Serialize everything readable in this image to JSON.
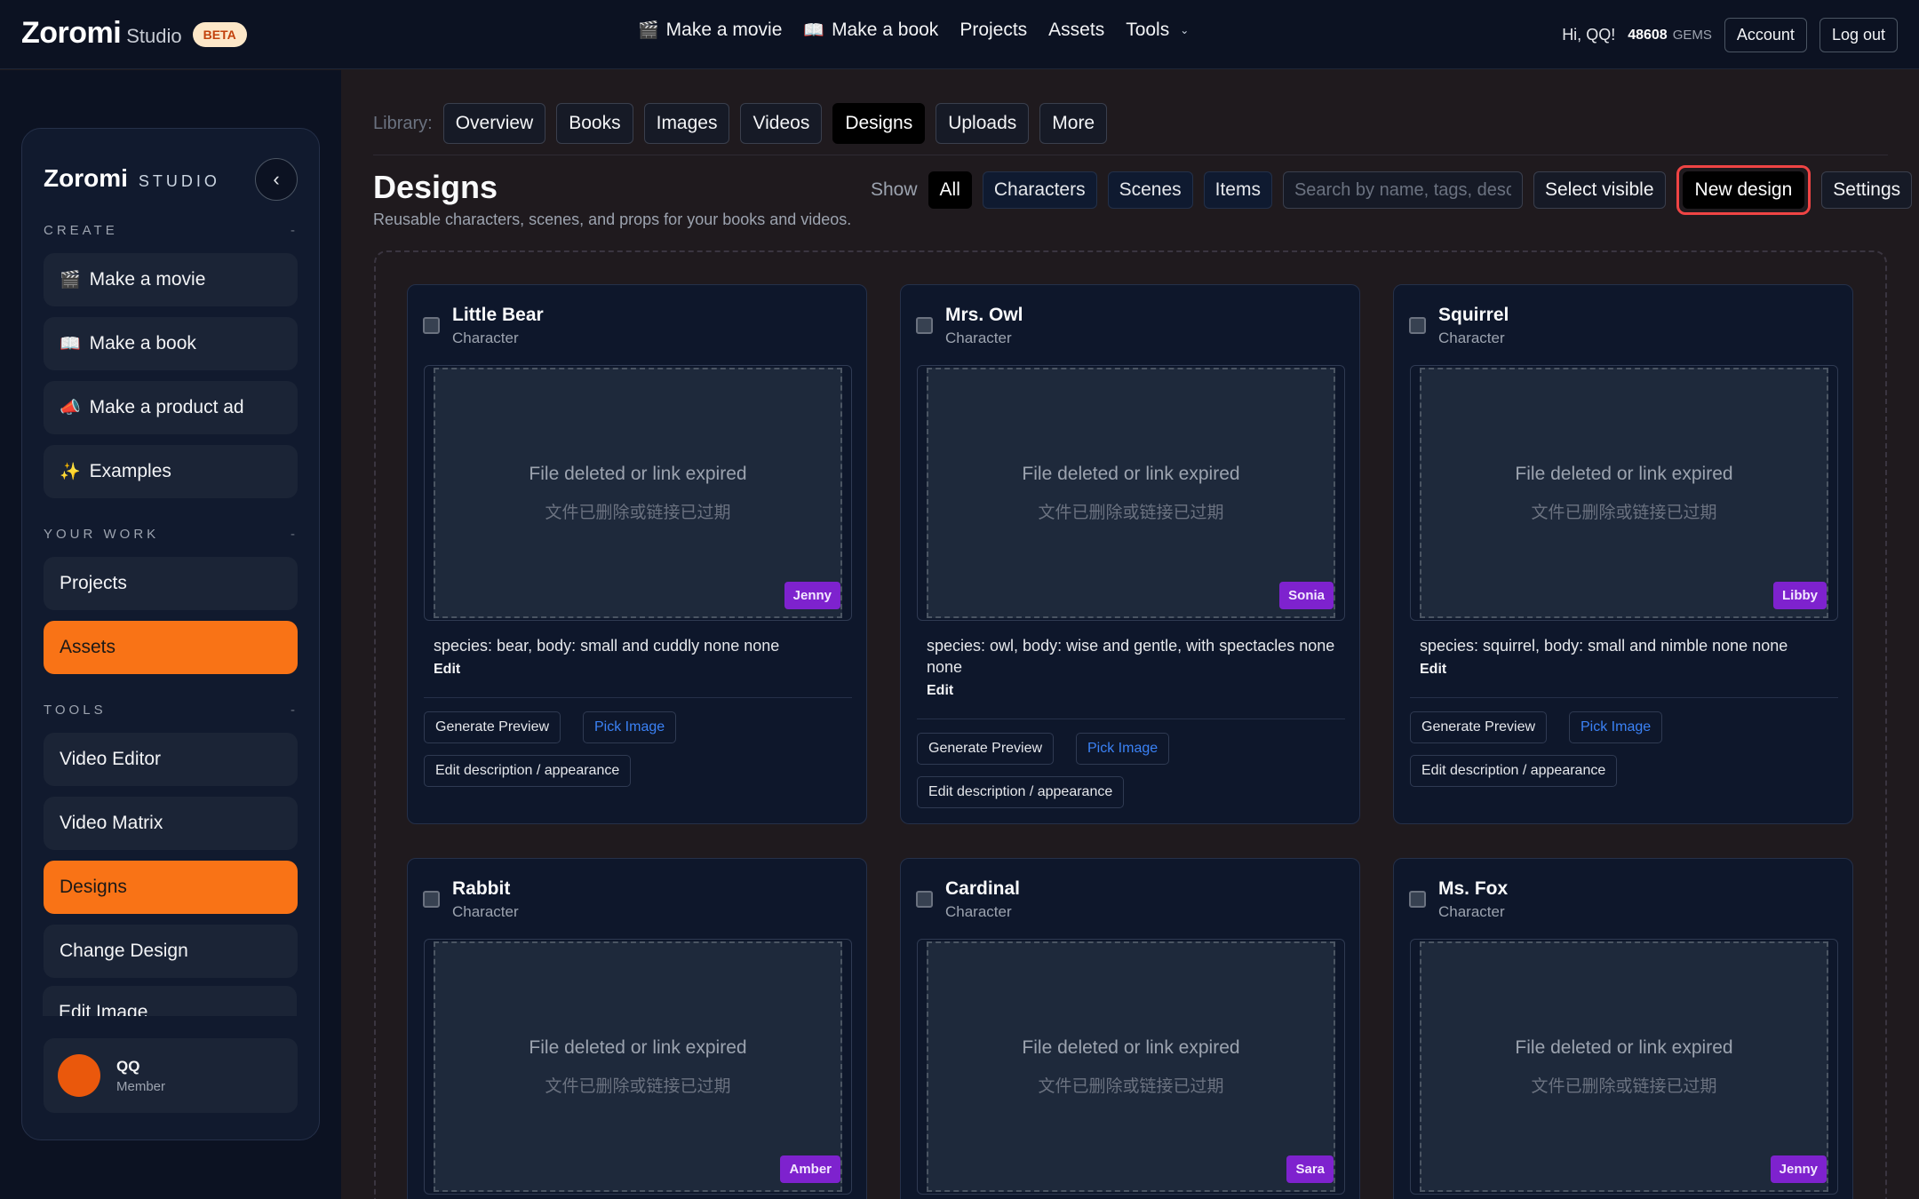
{
  "topbar": {
    "brand": "Zoromi",
    "brand_sub": "Studio",
    "beta": "BETA",
    "nav": [
      {
        "icon": "clapper-icon",
        "glyph": "🎬",
        "label": "Make a movie"
      },
      {
        "icon": "book-icon",
        "glyph": "📖",
        "label": "Make a book"
      },
      {
        "label": "Projects"
      },
      {
        "label": "Assets"
      },
      {
        "label": "Tools"
      }
    ],
    "greeting": "Hi, QQ!",
    "gems_value": "48608",
    "gems_unit": "GEMS",
    "account": "Account",
    "logout": "Log out"
  },
  "sidebar": {
    "brand": "Zoromi",
    "brand_sub": "STUDIO",
    "collapse_glyph": "‹",
    "sections": [
      {
        "label": "CREATE",
        "dash": "-"
      },
      {
        "label": "YOUR WORK",
        "dash": "-"
      },
      {
        "label": "TOOLS",
        "dash": "-"
      }
    ],
    "create": [
      {
        "glyph": "🎬",
        "label": "Make a movie"
      },
      {
        "glyph": "📖",
        "label": "Make a book"
      },
      {
        "glyph": "📣",
        "label": "Make a product ad"
      },
      {
        "glyph": "✨",
        "label": "Examples"
      }
    ],
    "work": [
      {
        "label": "Projects"
      },
      {
        "label": "Assets"
      }
    ],
    "tools": [
      {
        "label": "Video Editor"
      },
      {
        "label": "Video Matrix"
      },
      {
        "label": "Designs"
      },
      {
        "label": "Change Design"
      },
      {
        "label": "Edit Image"
      }
    ],
    "user": {
      "name": "QQ",
      "role": "Member"
    }
  },
  "library": {
    "label": "Library:",
    "tabs": [
      "Overview",
      "Books",
      "Images",
      "Videos",
      "Designs",
      "Uploads",
      "More"
    ],
    "active_tab": "Designs"
  },
  "page": {
    "title": "Designs",
    "subtitle": "Reusable characters, scenes, and props for your books and videos."
  },
  "filters": {
    "show_label": "Show",
    "chips": [
      "All",
      "Characters",
      "Scenes",
      "Items"
    ],
    "active_chip": "All",
    "search_placeholder": "Search by name, tags, description",
    "select_visible": "Select visible",
    "new_design": "New design",
    "settings": "Settings"
  },
  "preview_text": {
    "line1": "File deleted or link expired",
    "line2": "文件已删除或链接已过期"
  },
  "actions": {
    "generate": "Generate Preview",
    "pick": "Pick Image",
    "edit_desc": "Edit description / appearance",
    "edit": "Edit"
  },
  "designs": [
    {
      "name": "Little Bear",
      "type": "Character",
      "badge": "Jenny",
      "desc": "species: bear, body: small and cuddly none none"
    },
    {
      "name": "Mrs. Owl",
      "type": "Character",
      "badge": "Sonia",
      "desc": "species: owl, body: wise and gentle, with spectacles none none"
    },
    {
      "name": "Squirrel",
      "type": "Character",
      "badge": "Libby",
      "desc": "species: squirrel, body: small and nimble none none"
    },
    {
      "name": "Rabbit",
      "type": "Character",
      "badge": "Amber",
      "desc": ""
    },
    {
      "name": "Cardinal",
      "type": "Character",
      "badge": "Sara",
      "desc": ""
    },
    {
      "name": "Ms. Fox",
      "type": "Character",
      "badge": "Jenny",
      "desc": ""
    }
  ],
  "colors": {
    "accent": "#f97316",
    "badge": "#7e22ce",
    "highlight": "#ef4444",
    "link": "#3b82f6"
  }
}
